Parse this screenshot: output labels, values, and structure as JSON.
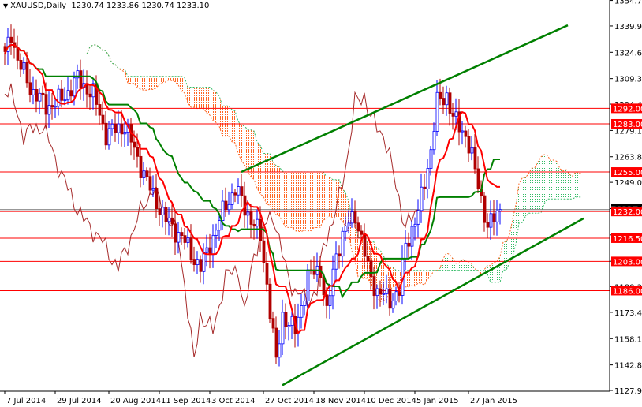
{
  "header": {
    "symbol": "XAUUSD,Daily",
    "open": "1230.74",
    "high": "1233.86",
    "low": "1230.74",
    "close": "1233.10"
  },
  "colors": {
    "up": "#0000ff",
    "down": "#b00000",
    "tenkan": "#ff0000",
    "kijun": "#008000",
    "chikou": "#a52a2a",
    "cloud_bull": "#33bb66",
    "cloud_bear": "#ff6622",
    "level": "#ff0000",
    "trendline": "#008000"
  },
  "chart_data": {
    "type": "candlestick",
    "title": "XAUUSD,Daily",
    "ylim": [
      1127.95,
      1354.75
    ],
    "y_ticks": [
      "1354.75",
      "1339.90",
      "1324.60",
      "1309.30",
      "1294.45",
      "1279.15",
      "1263.85",
      "1249.00",
      "1233.70",
      "1218.40",
      "1203.10",
      "1188.35",
      "1173.40",
      "1158.10",
      "1142.80",
      "1127.95"
    ],
    "x_ticks": [
      {
        "bar": 0,
        "label": "7 Jul 2014"
      },
      {
        "bar": 16,
        "label": "29 Jul 2014"
      },
      {
        "bar": 33,
        "label": "20 Aug 2014"
      },
      {
        "bar": 49,
        "label": "11 Sep 2014"
      },
      {
        "bar": 65,
        "label": "3 Oct 2014"
      },
      {
        "bar": 82,
        "label": "27 Oct 2014"
      },
      {
        "bar": 98,
        "label": "18 Nov 2014"
      },
      {
        "bar": 114,
        "label": "10 Dec 2014"
      },
      {
        "bar": 130,
        "label": "5 Jan 2015"
      },
      {
        "bar": 147,
        "label": "27 Jan 2015"
      }
    ],
    "close_keypoints": [
      [
        0,
        1322
      ],
      [
        2,
        1336
      ],
      [
        4,
        1320
      ],
      [
        8,
        1304
      ],
      [
        13,
        1293
      ],
      [
        18,
        1297
      ],
      [
        23,
        1309
      ],
      [
        28,
        1300
      ],
      [
        32,
        1277
      ],
      [
        38,
        1282
      ],
      [
        42,
        1263
      ],
      [
        46,
        1245
      ],
      [
        51,
        1227
      ],
      [
        56,
        1217
      ],
      [
        62,
        1199
      ],
      [
        65,
        1213
      ],
      [
        70,
        1236
      ],
      [
        73,
        1245
      ],
      [
        77,
        1231
      ],
      [
        81,
        1217
      ],
      [
        83,
        1190
      ],
      [
        86,
        1144
      ],
      [
        88,
        1172
      ],
      [
        92,
        1162
      ],
      [
        96,
        1194
      ],
      [
        100,
        1199
      ],
      [
        102,
        1172
      ],
      [
        105,
        1208
      ],
      [
        108,
        1222
      ],
      [
        111,
        1231
      ],
      [
        115,
        1199
      ],
      [
        118,
        1185
      ],
      [
        122,
        1181
      ],
      [
        125,
        1185
      ],
      [
        127,
        1213
      ],
      [
        131,
        1231
      ],
      [
        135,
        1268
      ],
      [
        137,
        1295
      ],
      [
        140,
        1300
      ],
      [
        142,
        1286
      ],
      [
        146,
        1277
      ],
      [
        148,
        1263
      ],
      [
        151,
        1240
      ],
      [
        153,
        1222
      ],
      [
        156,
        1231
      ],
      [
        157,
        1233.1
      ]
    ],
    "indicator": "Ichimoku (9, 26, 52)",
    "levels": [
      "1292.00",
      "1283.00",
      "1255.00",
      "1232.00",
      "1216.50",
      "1203.00",
      "1186.00"
    ],
    "current_price": 1233.1,
    "trendlines": [
      {
        "name": "upper-channel",
        "from": [
          75,
          1255
        ],
        "to": [
          178.5,
          1340.3
        ]
      },
      {
        "name": "lower-trendline",
        "from": [
          88,
          1131
        ],
        "to": [
          183.5,
          1228
        ]
      }
    ]
  }
}
